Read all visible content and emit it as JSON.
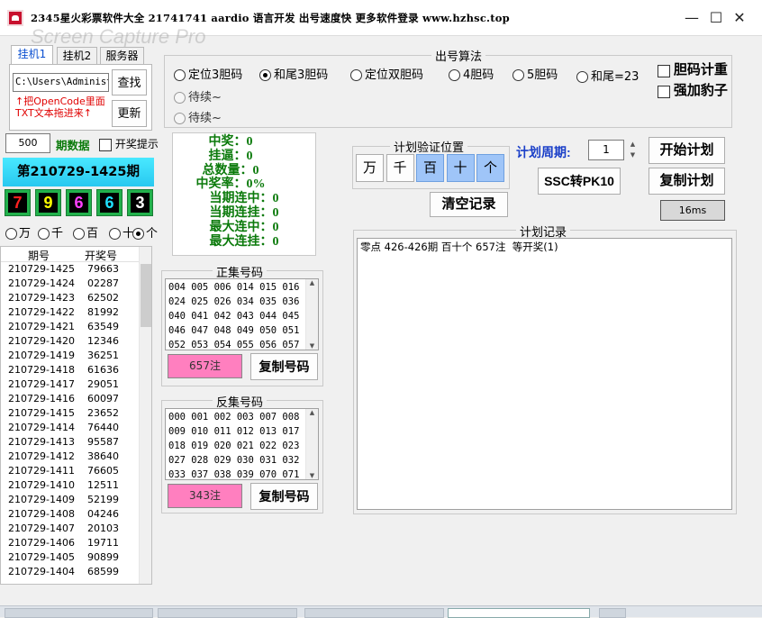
{
  "window": {
    "title": "2345星火彩票软件大全 21741741  aardio 语言开发  出号速度快  更多软件登录  www.hzhsc.top",
    "watermark": "Screen Capture Pro",
    "min_glyph": "—",
    "max_glyph": "☐",
    "close_glyph": "✕"
  },
  "tabs": [
    {
      "label": "挂机1",
      "active": true
    },
    {
      "label": "挂机2",
      "active": false
    },
    {
      "label": "服务器",
      "active": false
    }
  ],
  "path_input": {
    "value": "C:\\Users\\Administ"
  },
  "lookup_button": "查找",
  "update_button": "更新",
  "drag_hint_line1": "↑把OpenCode里面",
  "drag_hint_line2": "TXT文本拖进来↑",
  "periods_input": {
    "value": "500"
  },
  "periods_label": "期数据",
  "lottery_notify_label": "开奖提示",
  "current_period": "第210729-1425期",
  "digits": [
    {
      "value": "7",
      "color": "#ff2020"
    },
    {
      "value": "9",
      "color": "#ffff00"
    },
    {
      "value": "6",
      "color": "#ff40ff"
    },
    {
      "value": "6",
      "color": "#20e0ff"
    },
    {
      "value": "3",
      "color": "#ffffff"
    }
  ],
  "position_radios": [
    {
      "label": "万",
      "checked": false
    },
    {
      "label": "千",
      "checked": false
    },
    {
      "label": "百",
      "checked": false
    },
    {
      "label": "十",
      "checked": false
    },
    {
      "label": "个",
      "checked": true
    }
  ],
  "history": {
    "headers": [
      "期号",
      "开奖号"
    ],
    "rows": [
      [
        "210729-1425",
        "79663"
      ],
      [
        "210729-1424",
        "02287"
      ],
      [
        "210729-1423",
        "62502"
      ],
      [
        "210729-1422",
        "81992"
      ],
      [
        "210729-1421",
        "63549"
      ],
      [
        "210729-1420",
        "12346"
      ],
      [
        "210729-1419",
        "36251"
      ],
      [
        "210729-1418",
        "61636"
      ],
      [
        "210729-1417",
        "29051"
      ],
      [
        "210729-1416",
        "60097"
      ],
      [
        "210729-1415",
        "23652"
      ],
      [
        "210729-1414",
        "76440"
      ],
      [
        "210729-1413",
        "95587"
      ],
      [
        "210729-1412",
        "38640"
      ],
      [
        "210729-1411",
        "76605"
      ],
      [
        "210729-1410",
        "12511"
      ],
      [
        "210729-1409",
        "52199"
      ],
      [
        "210729-1408",
        "04246"
      ],
      [
        "210729-1407",
        "20103"
      ],
      [
        "210729-1406",
        "19711"
      ],
      [
        "210729-1405",
        "90899"
      ],
      [
        "210729-1404",
        "68599"
      ]
    ]
  },
  "algo_group": {
    "title": "出号算法",
    "options": [
      {
        "label": "定位3胆码",
        "checked": false,
        "disabled": false
      },
      {
        "label": "和尾3胆码",
        "checked": true,
        "disabled": false
      },
      {
        "label": "定位双胆码",
        "checked": false,
        "disabled": false
      },
      {
        "label": "4胆码",
        "checked": false,
        "disabled": false
      },
      {
        "label": "5胆码",
        "checked": false,
        "disabled": false
      },
      {
        "label": "和尾=23",
        "checked": false,
        "disabled": false
      },
      {
        "label": "待续~",
        "checked": false,
        "disabled": true
      },
      {
        "label": "待续~",
        "checked": false,
        "disabled": true
      }
    ],
    "dedupe_label": "胆码计重",
    "leopard_label": "强加豹子"
  },
  "stats": {
    "hits": "中奖：0",
    "misses": "挂逼：0",
    "total": "总数量：0",
    "rate": "中奖率：0%",
    "cur_streak_hit": "当期连中：0",
    "cur_streak_miss": "当期连挂：0",
    "max_streak_hit": "最大连中：0",
    "max_streak_miss": "最大连挂：0"
  },
  "verify_group": {
    "title": "计划验证位置",
    "positions": [
      {
        "label": "万",
        "on": false
      },
      {
        "label": "千",
        "on": false
      },
      {
        "label": "百",
        "on": true
      },
      {
        "label": "十",
        "on": true
      },
      {
        "label": "个",
        "on": true
      }
    ],
    "clear_button": "清空记录"
  },
  "plan_cycle": {
    "label": "计划周期:",
    "value": "1"
  },
  "start_button": "开始计划",
  "copy_plan_button": "复制计划",
  "convert_button": "SSC转PK10",
  "timer_text": "16ms",
  "positive_group": {
    "title": "正集号码",
    "rows": [
      "004 005 006 014 015 016",
      "024 025 026 034 035 036",
      "040 041 042 043 044 045",
      "046 047 048 049 050 051",
      "052 053 054 055 056 057"
    ],
    "count_label": "657注",
    "copy_button": "复制号码"
  },
  "negative_group": {
    "title": "反集号码",
    "rows": [
      "000 001 002 003 007 008",
      "009 010 011 012 013 017",
      "018 019 020 021 022 023",
      "027 028 029 030 031 032",
      "033 037 038 039 070 071"
    ],
    "count_label": "343注",
    "copy_button": "复制号码"
  },
  "log_group": {
    "title": "计划记录",
    "lines": [
      "零点 426-426期 百十个 657注  等开奖(1)"
    ]
  }
}
